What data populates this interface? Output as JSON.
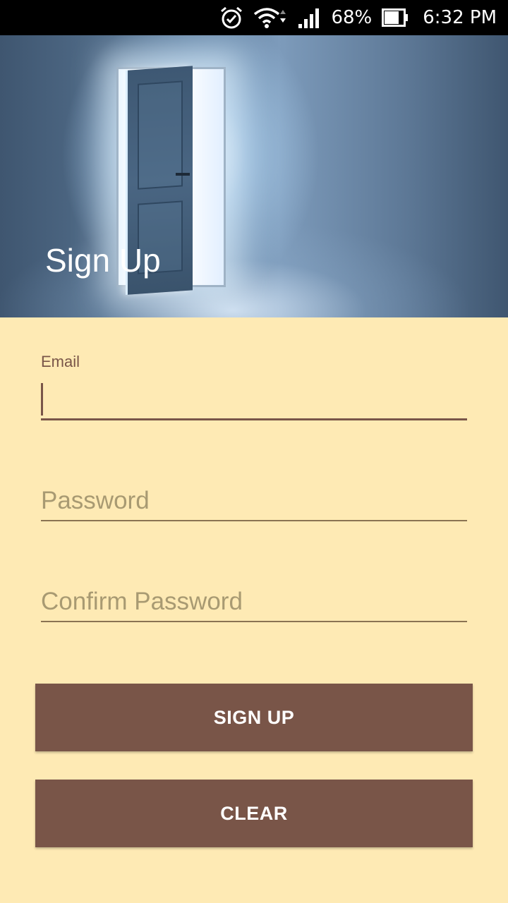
{
  "status_bar": {
    "alarm_icon": "alarm-clock-icon",
    "wifi_icon": "wifi-icon",
    "signal_icon": "cell-signal-icon",
    "battery_icon": "battery-icon",
    "battery_percent": "68%",
    "time": "6:32 PM"
  },
  "header": {
    "title": "Sign Up",
    "image": "open-door-image"
  },
  "form": {
    "email_label": "Email",
    "email_value": "",
    "password_placeholder": "Password",
    "confirm_password_placeholder": "Confirm Password"
  },
  "buttons": {
    "sign_up": "SIGN UP",
    "clear": "CLEAR"
  },
  "colors": {
    "background": "#FEEAB4",
    "accent_brown": "#795548",
    "placeholder": "#A89A72"
  }
}
